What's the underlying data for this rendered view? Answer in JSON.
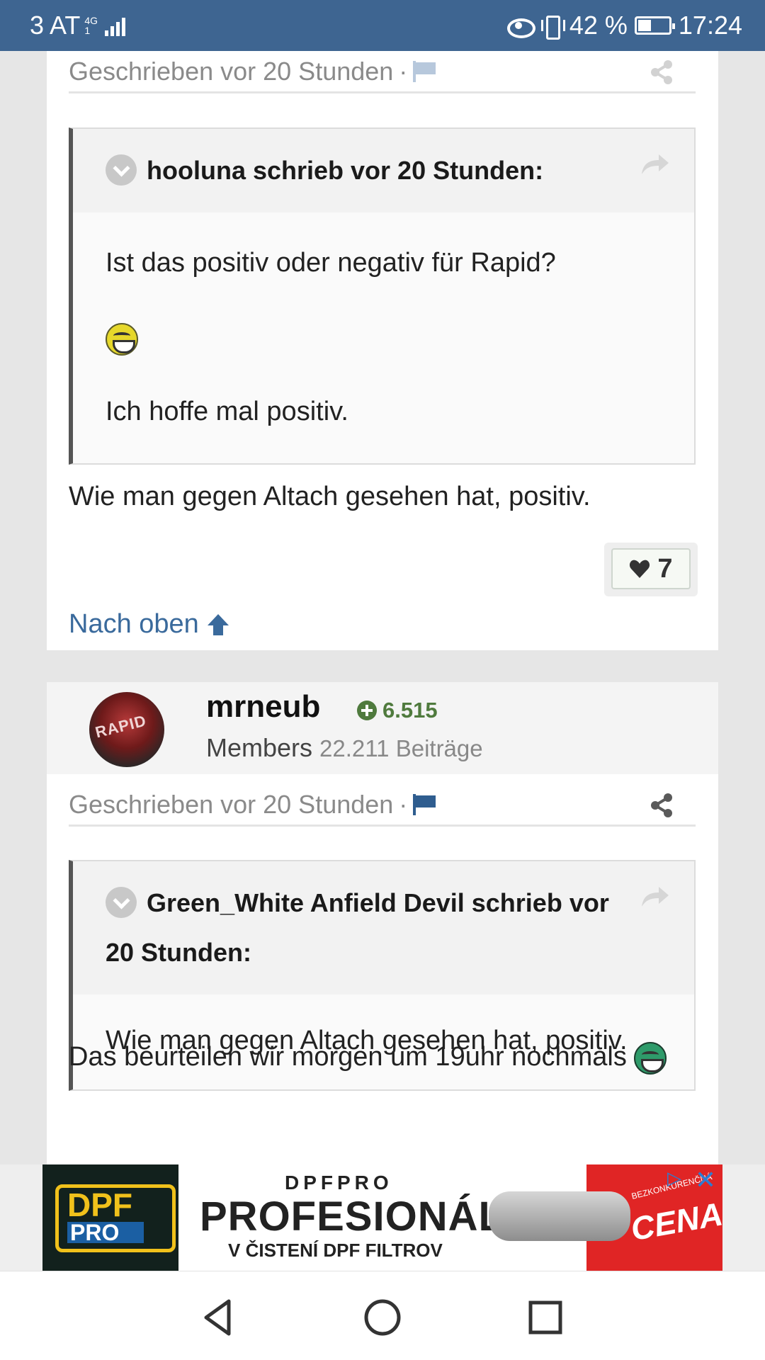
{
  "status_bar": {
    "carrier": "3 AT",
    "network_type": "4G",
    "network_sub": "1",
    "battery_percent": "42 %",
    "battery_level": 0.42,
    "time": "17:24"
  },
  "post1": {
    "meta": "Geschrieben vor 20 Stunden",
    "meta_sep": "·",
    "quote": {
      "header": "hooluna schrieb vor 20 Stunden:",
      "line1": "Ist das positiv oder negativ für Rapid?",
      "line2": "Ich hoffe mal positiv."
    },
    "body": "Wie man gegen Altach gesehen hat, positiv.",
    "likes": "7",
    "back_to_top": "Nach oben"
  },
  "post2": {
    "author": "mrneub",
    "avatar_text": "RAPID",
    "reputation": "6.515",
    "group": "Members",
    "post_count": "22.211 Beiträge",
    "meta": "Geschrieben vor 20 Stunden",
    "meta_sep": "·",
    "quote": {
      "header": "Green_White Anfield Devil schrieb vor 20 Stunden:",
      "line1": "Wie man gegen Altach gesehen hat, positiv."
    },
    "body": "Das beurteilen wir morgen um 19uhr nochmals"
  },
  "ad": {
    "logo_top": "DPF",
    "logo_bottom": "PRO",
    "kicker": "DPFPRO",
    "title": "PROFESIONÁL",
    "subtitle": "V ČISTENÍ DPF FILTROV",
    "badge": "BEZKONKURENČNÁ",
    "price_label": "CENA!"
  },
  "colors": {
    "status_bar": "#3e6591",
    "link": "#3a6a9c",
    "reputation": "#4f7a3d"
  }
}
